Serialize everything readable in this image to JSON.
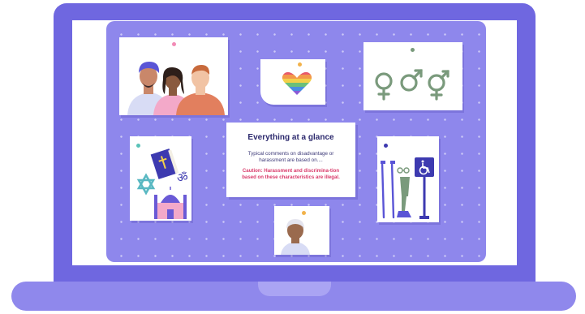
{
  "card": {
    "title": "Everything at a glance",
    "body": "Typical comments on disadvantage or harassment are based on....",
    "caution": "Caution: Harassment and discrimina-tion based on these characteristics are illegal."
  },
  "colors": {
    "laptop_frame": "#6f67e0",
    "board": "#8e87ec",
    "title_text": "#2d2a6e",
    "caution_text": "#d93a6a",
    "symbol_green": "#7a9a7c"
  },
  "icons": {
    "people": "people-illustration",
    "heart": "rainbow-heart-icon",
    "gender": "gender-symbols-icon",
    "religion": "religion-symbols-icon",
    "disability": "disability-aids-icon",
    "age": "elderly-person-icon"
  }
}
